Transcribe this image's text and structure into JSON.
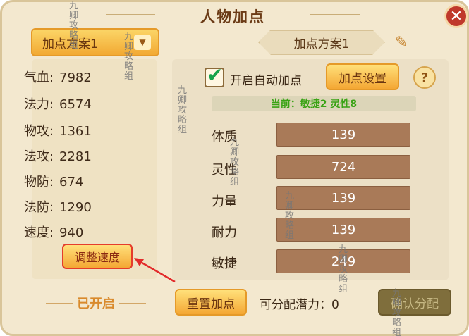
{
  "title": "人物加点",
  "plan_dropdown": {
    "label": "加点方案1"
  },
  "plan_tab": {
    "label": "加点方案1"
  },
  "stats": [
    {
      "label": "气血:",
      "value": "7982"
    },
    {
      "label": "法力:",
      "value": "6574"
    },
    {
      "label": "物攻:",
      "value": "1361"
    },
    {
      "label": "法攻:",
      "value": "2281"
    },
    {
      "label": "物防:",
      "value": "674"
    },
    {
      "label": "法防:",
      "value": "1290"
    },
    {
      "label": "速度:",
      "value": "940"
    }
  ],
  "adjust_speed": "调整速度",
  "opened": "已开启",
  "auto_add": {
    "label": "开启自动加点",
    "checked": true
  },
  "setting_button": "加点设置",
  "help": "?",
  "current": "当前：敏捷2 灵性8",
  "attributes": [
    {
      "label": "体质",
      "value": "139"
    },
    {
      "label": "灵性",
      "value": "724"
    },
    {
      "label": "力量",
      "value": "139"
    },
    {
      "label": "耐力",
      "value": "139"
    },
    {
      "label": "敏捷",
      "value": "249"
    }
  ],
  "reset_button": "重置加点",
  "potential": "可分配潜力：0",
  "confirm_button": "确认分配",
  "close": "✕",
  "watermark": "九卿攻略组",
  "colors": {
    "accent": "#f4a734",
    "current_text": "#3aa315",
    "attr_bar": "#a97a58"
  }
}
